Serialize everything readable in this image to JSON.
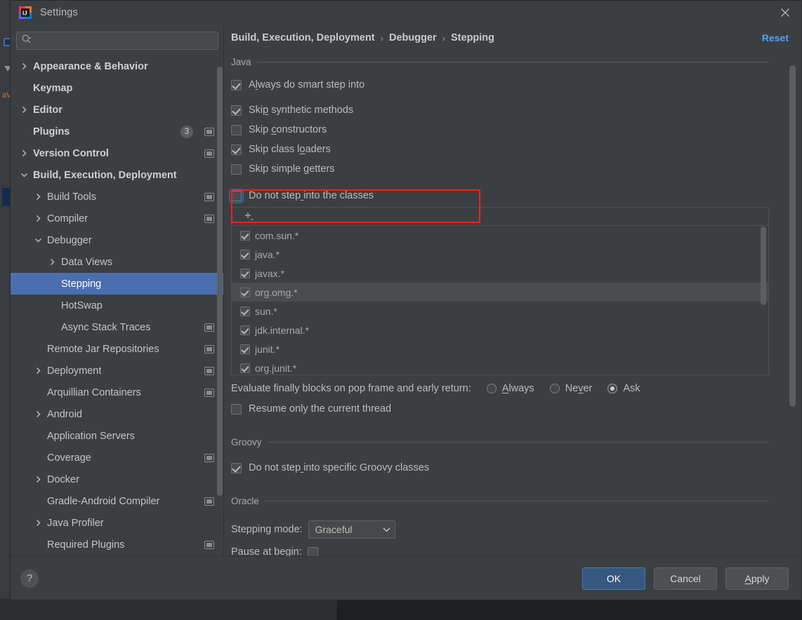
{
  "window": {
    "title": "Settings",
    "logo_icon": "intellij-idea-logo",
    "close_icon": "close-icon"
  },
  "search": {
    "placeholder": "",
    "value": "",
    "icon": "search-icon",
    "dropdown_icon": "chevron-down-icon"
  },
  "sidebar": {
    "items": [
      {
        "label": "Appearance & Behavior",
        "indent": 0,
        "arrow": "collapsed",
        "bold": true,
        "selected": false,
        "badge": null,
        "project_icon": false
      },
      {
        "label": "Keymap",
        "indent": 0,
        "arrow": "none",
        "bold": true,
        "selected": false,
        "badge": null,
        "project_icon": false
      },
      {
        "label": "Editor",
        "indent": 0,
        "arrow": "collapsed",
        "bold": true,
        "selected": false,
        "badge": null,
        "project_icon": false
      },
      {
        "label": "Plugins",
        "indent": 0,
        "arrow": "none",
        "bold": true,
        "selected": false,
        "badge": "3",
        "project_icon": true
      },
      {
        "label": "Version Control",
        "indent": 0,
        "arrow": "collapsed",
        "bold": true,
        "selected": false,
        "badge": null,
        "project_icon": true
      },
      {
        "label": "Build, Execution, Deployment",
        "indent": 0,
        "arrow": "expanded",
        "bold": true,
        "selected": false,
        "badge": null,
        "project_icon": false
      },
      {
        "label": "Build Tools",
        "indent": 1,
        "arrow": "collapsed",
        "bold": false,
        "selected": false,
        "badge": null,
        "project_icon": true
      },
      {
        "label": "Compiler",
        "indent": 1,
        "arrow": "collapsed",
        "bold": false,
        "selected": false,
        "badge": null,
        "project_icon": true
      },
      {
        "label": "Debugger",
        "indent": 1,
        "arrow": "expanded",
        "bold": false,
        "selected": false,
        "badge": null,
        "project_icon": false
      },
      {
        "label": "Data Views",
        "indent": 2,
        "arrow": "collapsed",
        "bold": false,
        "selected": false,
        "badge": null,
        "project_icon": false
      },
      {
        "label": "Stepping",
        "indent": 2,
        "arrow": "none",
        "bold": false,
        "selected": true,
        "badge": null,
        "project_icon": false
      },
      {
        "label": "HotSwap",
        "indent": 2,
        "arrow": "none",
        "bold": false,
        "selected": false,
        "badge": null,
        "project_icon": false
      },
      {
        "label": "Async Stack Traces",
        "indent": 2,
        "arrow": "none",
        "bold": false,
        "selected": false,
        "badge": null,
        "project_icon": true
      },
      {
        "label": "Remote Jar Repositories",
        "indent": 1,
        "arrow": "none",
        "bold": false,
        "selected": false,
        "badge": null,
        "project_icon": true
      },
      {
        "label": "Deployment",
        "indent": 1,
        "arrow": "collapsed",
        "bold": false,
        "selected": false,
        "badge": null,
        "project_icon": true
      },
      {
        "label": "Arquillian Containers",
        "indent": 1,
        "arrow": "none",
        "bold": false,
        "selected": false,
        "badge": null,
        "project_icon": true
      },
      {
        "label": "Android",
        "indent": 1,
        "arrow": "collapsed",
        "bold": false,
        "selected": false,
        "badge": null,
        "project_icon": false
      },
      {
        "label": "Application Servers",
        "indent": 1,
        "arrow": "none",
        "bold": false,
        "selected": false,
        "badge": null,
        "project_icon": false
      },
      {
        "label": "Coverage",
        "indent": 1,
        "arrow": "none",
        "bold": false,
        "selected": false,
        "badge": null,
        "project_icon": true
      },
      {
        "label": "Docker",
        "indent": 1,
        "arrow": "collapsed",
        "bold": false,
        "selected": false,
        "badge": null,
        "project_icon": false
      },
      {
        "label": "Gradle-Android Compiler",
        "indent": 1,
        "arrow": "none",
        "bold": false,
        "selected": false,
        "badge": null,
        "project_icon": true
      },
      {
        "label": "Java Profiler",
        "indent": 1,
        "arrow": "collapsed",
        "bold": false,
        "selected": false,
        "badge": null,
        "project_icon": false
      },
      {
        "label": "Required Plugins",
        "indent": 1,
        "arrow": "none",
        "bold": false,
        "selected": false,
        "badge": null,
        "project_icon": true
      }
    ]
  },
  "breadcrumb": {
    "crumbs": [
      "Build, Execution, Deployment",
      "Debugger",
      "Stepping"
    ],
    "separator": "›",
    "reset_label": "Reset"
  },
  "main": {
    "java_group": {
      "title": "Java",
      "checkboxes": [
        {
          "label": "Always do smart step into",
          "checked": true,
          "mnemonic_index": 1,
          "focused": false
        },
        {
          "label": "Skip synthetic methods",
          "checked": true,
          "mnemonic_index": 3,
          "focused": false
        },
        {
          "label": "Skip constructors",
          "checked": false,
          "mnemonic_index": 5,
          "focused": false
        },
        {
          "label": "Skip class loaders",
          "checked": true,
          "mnemonic_index": 12,
          "focused": false
        },
        {
          "label": "Skip simple getters",
          "checked": false,
          "mnemonic_index": 12,
          "focused": false
        }
      ],
      "do_not_step_into": {
        "label": "Do not step into the classes",
        "checked": false,
        "mnemonic_index": 11,
        "focused": true,
        "annotated": true
      },
      "class_list": {
        "add_button_icon": "plus-with-dropdown-icon",
        "items": [
          {
            "name": "com.sun.*",
            "checked": true,
            "highlighted": false
          },
          {
            "name": "java.*",
            "checked": true,
            "highlighted": false
          },
          {
            "name": "javax.*",
            "checked": true,
            "highlighted": false
          },
          {
            "name": "org.omg.*",
            "checked": true,
            "highlighted": true
          },
          {
            "name": "sun.*",
            "checked": true,
            "highlighted": false
          },
          {
            "name": "jdk.internal.*",
            "checked": true,
            "highlighted": false
          },
          {
            "name": "junit.*",
            "checked": true,
            "highlighted": false
          },
          {
            "name": "org.junit.*",
            "checked": true,
            "highlighted": false
          }
        ]
      },
      "finally_blocks": {
        "label": "Evaluate finally blocks on pop frame and early return:",
        "options": [
          {
            "label": "Always",
            "selected": false,
            "mnemonic_index": 0
          },
          {
            "label": "Never",
            "selected": false,
            "mnemonic_index": 2
          },
          {
            "label": "Ask",
            "selected": true,
            "mnemonic_index": -1
          }
        ]
      },
      "resume_only": {
        "label": "Resume only the current thread",
        "checked": false,
        "mnemonic_index": -1
      }
    },
    "groovy_group": {
      "title": "Groovy",
      "checkbox": {
        "label": "Do not step into specific Groovy classes",
        "checked": true,
        "mnemonic_index": 11
      }
    },
    "oracle_group": {
      "title": "Oracle",
      "stepping_mode": {
        "label": "Stepping mode:",
        "value": "Graceful",
        "caret_icon": "chevron-down-icon"
      },
      "pause_at_begin": {
        "label": "Pause at begin:",
        "checked": false
      }
    }
  },
  "footer": {
    "help_label": "?",
    "help_icon": "help-icon",
    "buttons": [
      {
        "label": "OK",
        "primary": true,
        "mnemonic_index": -1
      },
      {
        "label": "Cancel",
        "primary": false,
        "mnemonic_index": -1
      },
      {
        "label": "Apply",
        "primary": false,
        "mnemonic_index": 0
      }
    ]
  },
  "colors": {
    "dialog_bg": "#3c3f41",
    "selection_blue": "#4b6eaf",
    "link_blue": "#589df6",
    "primary_button": "#365880",
    "annotation_red": "#f52020",
    "text": "#bbbbbb"
  }
}
